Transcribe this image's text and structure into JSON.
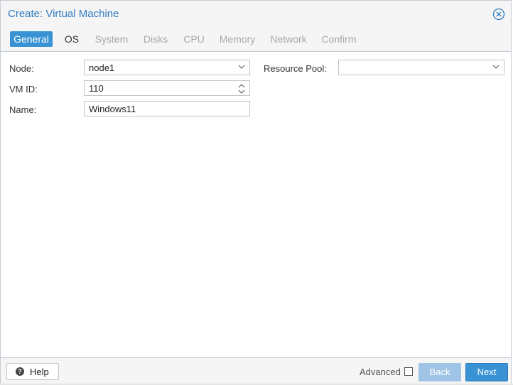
{
  "window": {
    "title": "Create: Virtual Machine"
  },
  "tabs": [
    {
      "label": "General",
      "state": "active"
    },
    {
      "label": "OS",
      "state": "enabled"
    },
    {
      "label": "System",
      "state": "disabled"
    },
    {
      "label": "Disks",
      "state": "disabled"
    },
    {
      "label": "CPU",
      "state": "disabled"
    },
    {
      "label": "Memory",
      "state": "disabled"
    },
    {
      "label": "Network",
      "state": "disabled"
    },
    {
      "label": "Confirm",
      "state": "disabled"
    }
  ],
  "form": {
    "node": {
      "label": "Node:",
      "value": "node1"
    },
    "vmid": {
      "label": "VM ID:",
      "value": "110"
    },
    "name": {
      "label": "Name:",
      "value": "Windows11"
    },
    "pool": {
      "label": "Resource Pool:",
      "value": ""
    }
  },
  "footer": {
    "help_label": "Help",
    "advanced_label": "Advanced",
    "advanced_checked": false,
    "back_label": "Back",
    "next_label": "Next"
  },
  "colors": {
    "accent": "#3892d4",
    "title": "#2e7bbf",
    "disabled_button": "#9fc4e6"
  }
}
